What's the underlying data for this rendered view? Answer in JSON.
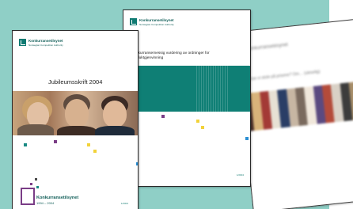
{
  "colors": {
    "teal_background": "#8fcfc6",
    "brand_teal": "#0f7a72",
    "purple": "#7a3d86",
    "yellow": "#f2d23a"
  },
  "doc1": {
    "brand": "Konkurransetilsynet",
    "brand_sub": "Norwegian Competition Authority",
    "title": "Jubileumsskrift 2004",
    "footer_brand": "Konkurransetilsynet",
    "footer_years": "1994 – 2004",
    "footer_page": "1/2004"
  },
  "doc2": {
    "brand": "Konkurransetilsynet",
    "brand_sub": "Norwegian Competition Authority",
    "title": "Konkurransemessig vurdering av ordninger for produktgjenvinning",
    "footer_page": "1/2004"
  },
  "doc3": {
    "brand_blurred": "Konkurransetilsynet",
    "subtitle_blurred": "Kan vi stole på prisene? Om… (uleselig)"
  }
}
